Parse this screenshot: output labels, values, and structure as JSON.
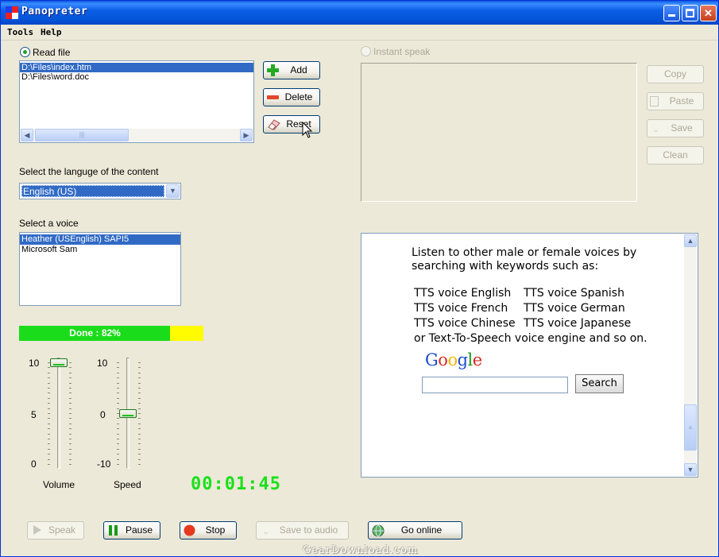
{
  "window": {
    "title": "Panopreter",
    "colors": {
      "title_bar": "#0b5fe6",
      "progress_done": "#1bdc1b",
      "progress_remaining": "#fffc00",
      "timer": "#1ae01a"
    }
  },
  "menu": {
    "tools_label": "Tools",
    "help_label": "Help"
  },
  "read_file": {
    "label": "Read file",
    "selected": true,
    "files": [
      "D:\\Files\\index.htm",
      "D:\\Files\\word.doc"
    ],
    "selected_index": 0
  },
  "file_buttons": {
    "add": "Add",
    "delete": "Delete",
    "reset": "Reset"
  },
  "language": {
    "label": "Select the languge of the content",
    "value": "English (US)"
  },
  "voice": {
    "label": "Select a voice",
    "options": [
      "Heather (USEnglish) SAPI5",
      "Microsoft Sam"
    ],
    "selected_index": 0
  },
  "progress": {
    "text": "Done : 82%",
    "value": 0.82
  },
  "volume": {
    "label": "Volume",
    "ticks": [
      "10",
      "5",
      "0"
    ],
    "value": 10
  },
  "speed": {
    "label": "Speed",
    "ticks": [
      "10",
      "0",
      "-10"
    ],
    "value": 0
  },
  "timer": "00:01:45",
  "instant_speak": {
    "label": "Instant speak",
    "enabled": false,
    "buttons": {
      "copy": "Copy",
      "paste": "Paste",
      "save": "Save",
      "clean": "Clean"
    }
  },
  "browser": {
    "intro_line1": "Listen to other male or female voices by",
    "intro_line2": "searching with keywords such as:",
    "keywords": [
      [
        "TTS voice English",
        "TTS voice Spanish"
      ],
      [
        "TTS voice French",
        "TTS voice German"
      ],
      [
        "TTS voice Chinese",
        "TTS voice Japanese"
      ]
    ],
    "outro": "or Text-To-Speech voice engine and so on.",
    "logo": "Google",
    "search_value": "",
    "search_button": "Search"
  },
  "bottom_buttons": {
    "speak": "Speak",
    "pause": "Pause",
    "stop": "Stop",
    "save_to_audio": "Save to audio",
    "go_online": "Go online"
  },
  "watermark": "GearDownload.com"
}
